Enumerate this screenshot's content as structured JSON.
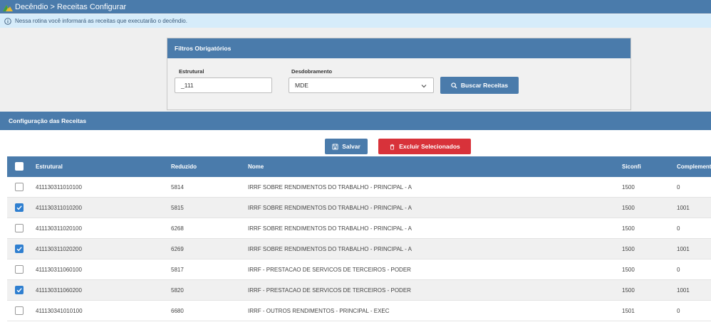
{
  "titlebar": {
    "title": "Decêndio > Receitas Configurar"
  },
  "info": {
    "text": "Nessa rotina você informará as receitas que executarão o decêndio."
  },
  "filters": {
    "title": "Filtros Obrigatórios",
    "estrutural_label": "Estrutural",
    "estrutural_value": "_111",
    "desdobramento_label": "Desdobramento",
    "desdobramento_value": "MDE",
    "search_label": "Buscar Receitas"
  },
  "config": {
    "title": "Configuração das Receitas",
    "save_label": "Salvar",
    "delete_label": "Excluir Selecionados"
  },
  "table": {
    "headers": {
      "estrutural": "Estrutural",
      "reduzido": "Reduzido",
      "nome": "Nome",
      "siconfi": "Siconfi",
      "complemento": "Complemento"
    },
    "rows": [
      {
        "checked": false,
        "estrutural": "411130311010100",
        "reduzido": "5814",
        "nome": "IRRF SOBRE RENDIMENTOS DO TRABALHO - PRINCIPAL - A",
        "siconfi": "1500",
        "complemento": "0"
      },
      {
        "checked": true,
        "estrutural": "411130311010200",
        "reduzido": "5815",
        "nome": "IRRF SOBRE RENDIMENTOS DO TRABALHO - PRINCIPAL - A",
        "siconfi": "1500",
        "complemento": "1001"
      },
      {
        "checked": false,
        "estrutural": "411130311020100",
        "reduzido": "6268",
        "nome": "IRRF SOBRE RENDIMENTOS DO TRABALHO - PRINCIPAL - A",
        "siconfi": "1500",
        "complemento": "0"
      },
      {
        "checked": true,
        "estrutural": "411130311020200",
        "reduzido": "6269",
        "nome": "IRRF SOBRE RENDIMENTOS DO TRABALHO - PRINCIPAL - A",
        "siconfi": "1500",
        "complemento": "1001"
      },
      {
        "checked": false,
        "estrutural": "411130311060100",
        "reduzido": "5817",
        "nome": "IRRF - PRESTACAO DE SERVICOS DE TERCEIROS - PODER",
        "siconfi": "1500",
        "complemento": "0"
      },
      {
        "checked": true,
        "estrutural": "411130311060200",
        "reduzido": "5820",
        "nome": "IRRF - PRESTACAO DE SERVICOS DE TERCEIROS - PODER",
        "siconfi": "1500",
        "complemento": "1001"
      },
      {
        "checked": false,
        "estrutural": "411130341010100",
        "reduzido": "6680",
        "nome": "IRRF - OUTROS RENDIMENTOS - PRINCIPAL - EXEC",
        "siconfi": "1501",
        "complemento": "0"
      }
    ]
  }
}
